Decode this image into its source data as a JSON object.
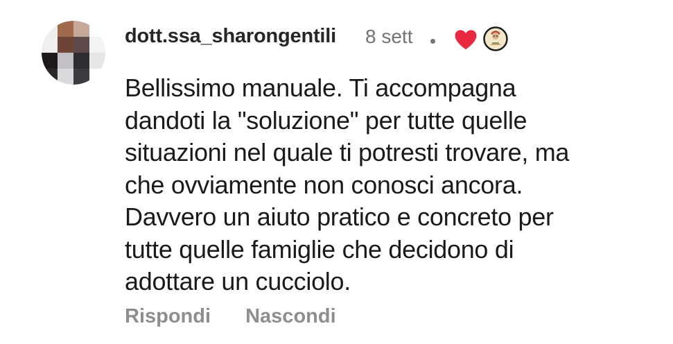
{
  "comment": {
    "username": "dott.ssa_sharongentili",
    "timestamp": "8 sett",
    "separator_icon": "dot-icon",
    "liked_by_creator_icon": "heart-icon",
    "creator_avatar_icon": "creator-avatar-icon",
    "body_lines": [
      "Bellissimo manuale. Ti accompagna",
      "dandoti la \"soluzione\" per tutte quelle",
      "situazioni nel quale ti potresti trovare, ma",
      "che ovviamente non conosci ancora.",
      "Davvero un aiuto pratico e concreto per",
      "tutte quelle famiglie che decidono di",
      "adottare un cucciolo."
    ],
    "actions": {
      "reply_label": "Rispondi",
      "hide_label": "Nascondi"
    }
  },
  "colors": {
    "heart": "#e8293f",
    "username": "#262626",
    "secondary_text": "#737373",
    "action_text": "#8e8e8e"
  }
}
